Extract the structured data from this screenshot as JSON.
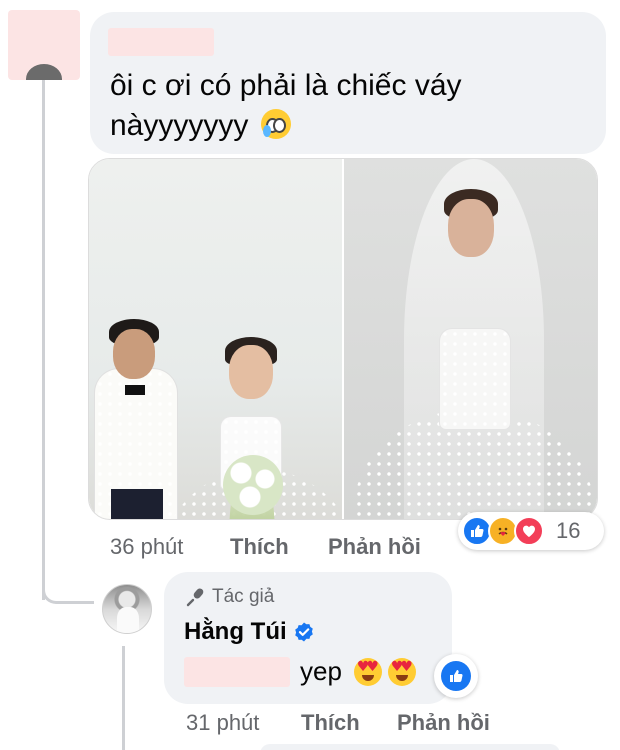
{
  "comment": {
    "text": "ôi c ơi có phải là chiếc váy nàyyyyyyy",
    "emoji": "crying-face-emoji",
    "time": "36 phút",
    "like_label": "Thích",
    "reply_label": "Phản hồi",
    "reaction_count": "16",
    "reactions": [
      "like",
      "care",
      "love"
    ]
  },
  "reply": {
    "author_badge": "Tác giả",
    "author_name": "Hằng Túi",
    "text": "yep",
    "time": "31 phút",
    "like_label": "Thích",
    "reply_label": "Phản hồi"
  },
  "colors": {
    "like_blue": "#1877f2",
    "love_red": "#f33e58",
    "care_yellow": "#f7b125",
    "bubble_bg": "#f0f2f5",
    "secondary_text": "#65676b",
    "redaction_pink": "#fce4e4"
  }
}
